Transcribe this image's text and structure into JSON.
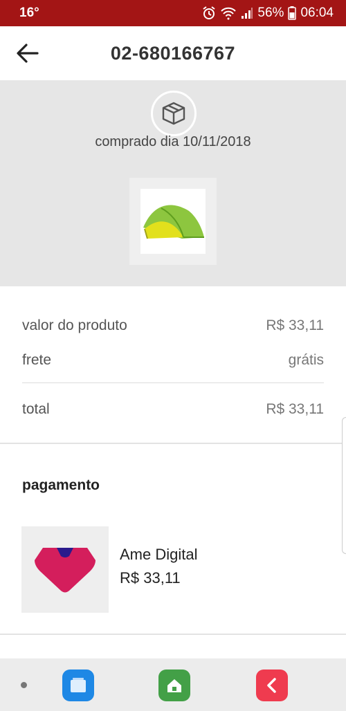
{
  "status_bar": {
    "left_text": "16°",
    "battery_percent": "56%",
    "time": "06:04",
    "background": "#a31515"
  },
  "app_bar": {
    "title": "02-680166767",
    "back_icon": "arrow-left-icon"
  },
  "order": {
    "status_icon": "package-box-icon",
    "purchase_date": "comprado dia 10/11/2018",
    "product_image": "green-yellow-tent"
  },
  "summary": {
    "product_value_label": "valor do produto",
    "product_value": "R$ 33,11",
    "shipping_label": "frete",
    "shipping_value": "grátis",
    "total_label": "total",
    "total_value": "R$ 33,11"
  },
  "payment": {
    "section_title": "pagamento",
    "method_name": "Ame Digital",
    "amount": "R$ 33,11",
    "logo_icon": "ame-digital-logo"
  },
  "dock": {
    "apps": [
      {
        "icon": "recent-apps-icon",
        "color": "#1e88e5"
      },
      {
        "icon": "home-icon",
        "color": "#43a047"
      },
      {
        "icon": "back-icon",
        "color": "#ef3b4f"
      }
    ]
  }
}
